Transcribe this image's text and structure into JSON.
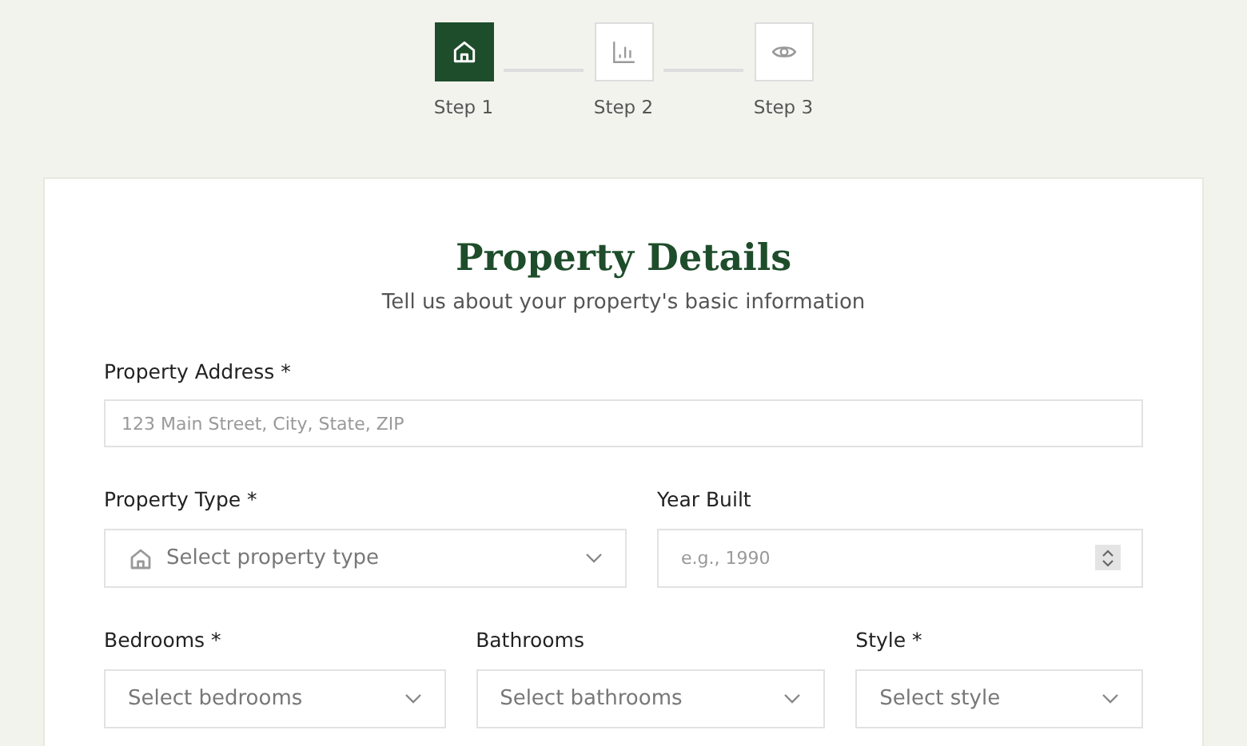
{
  "steps": [
    {
      "label": "Step 1",
      "kind": "home",
      "selected": true
    },
    {
      "label": "Step 2",
      "kind": "chart",
      "selected": false
    },
    {
      "label": "Step 3",
      "kind": "eye",
      "selected": false
    }
  ],
  "form": {
    "title": "Property Details",
    "subtitle": "Tell us about your property's basic information",
    "rows": [
      [
        {
          "label": "Property Address *",
          "kind": "text",
          "placeholder": "123 Main Street, City, State, ZIP"
        }
      ],
      [
        {
          "label": "Property Type *",
          "kind": "icon-select",
          "placeholder": "Select property type"
        },
        {
          "label": "Year Built",
          "kind": "number",
          "placeholder": "e.g., 1990"
        }
      ],
      [
        {
          "label": "Bedrooms *",
          "kind": "select",
          "placeholder": "Select bedrooms"
        },
        {
          "label": "Bathrooms",
          "kind": "select",
          "placeholder": "Select bathrooms"
        },
        {
          "label": "Style *",
          "kind": "select",
          "placeholder": "Select style"
        }
      ]
    ]
  }
}
